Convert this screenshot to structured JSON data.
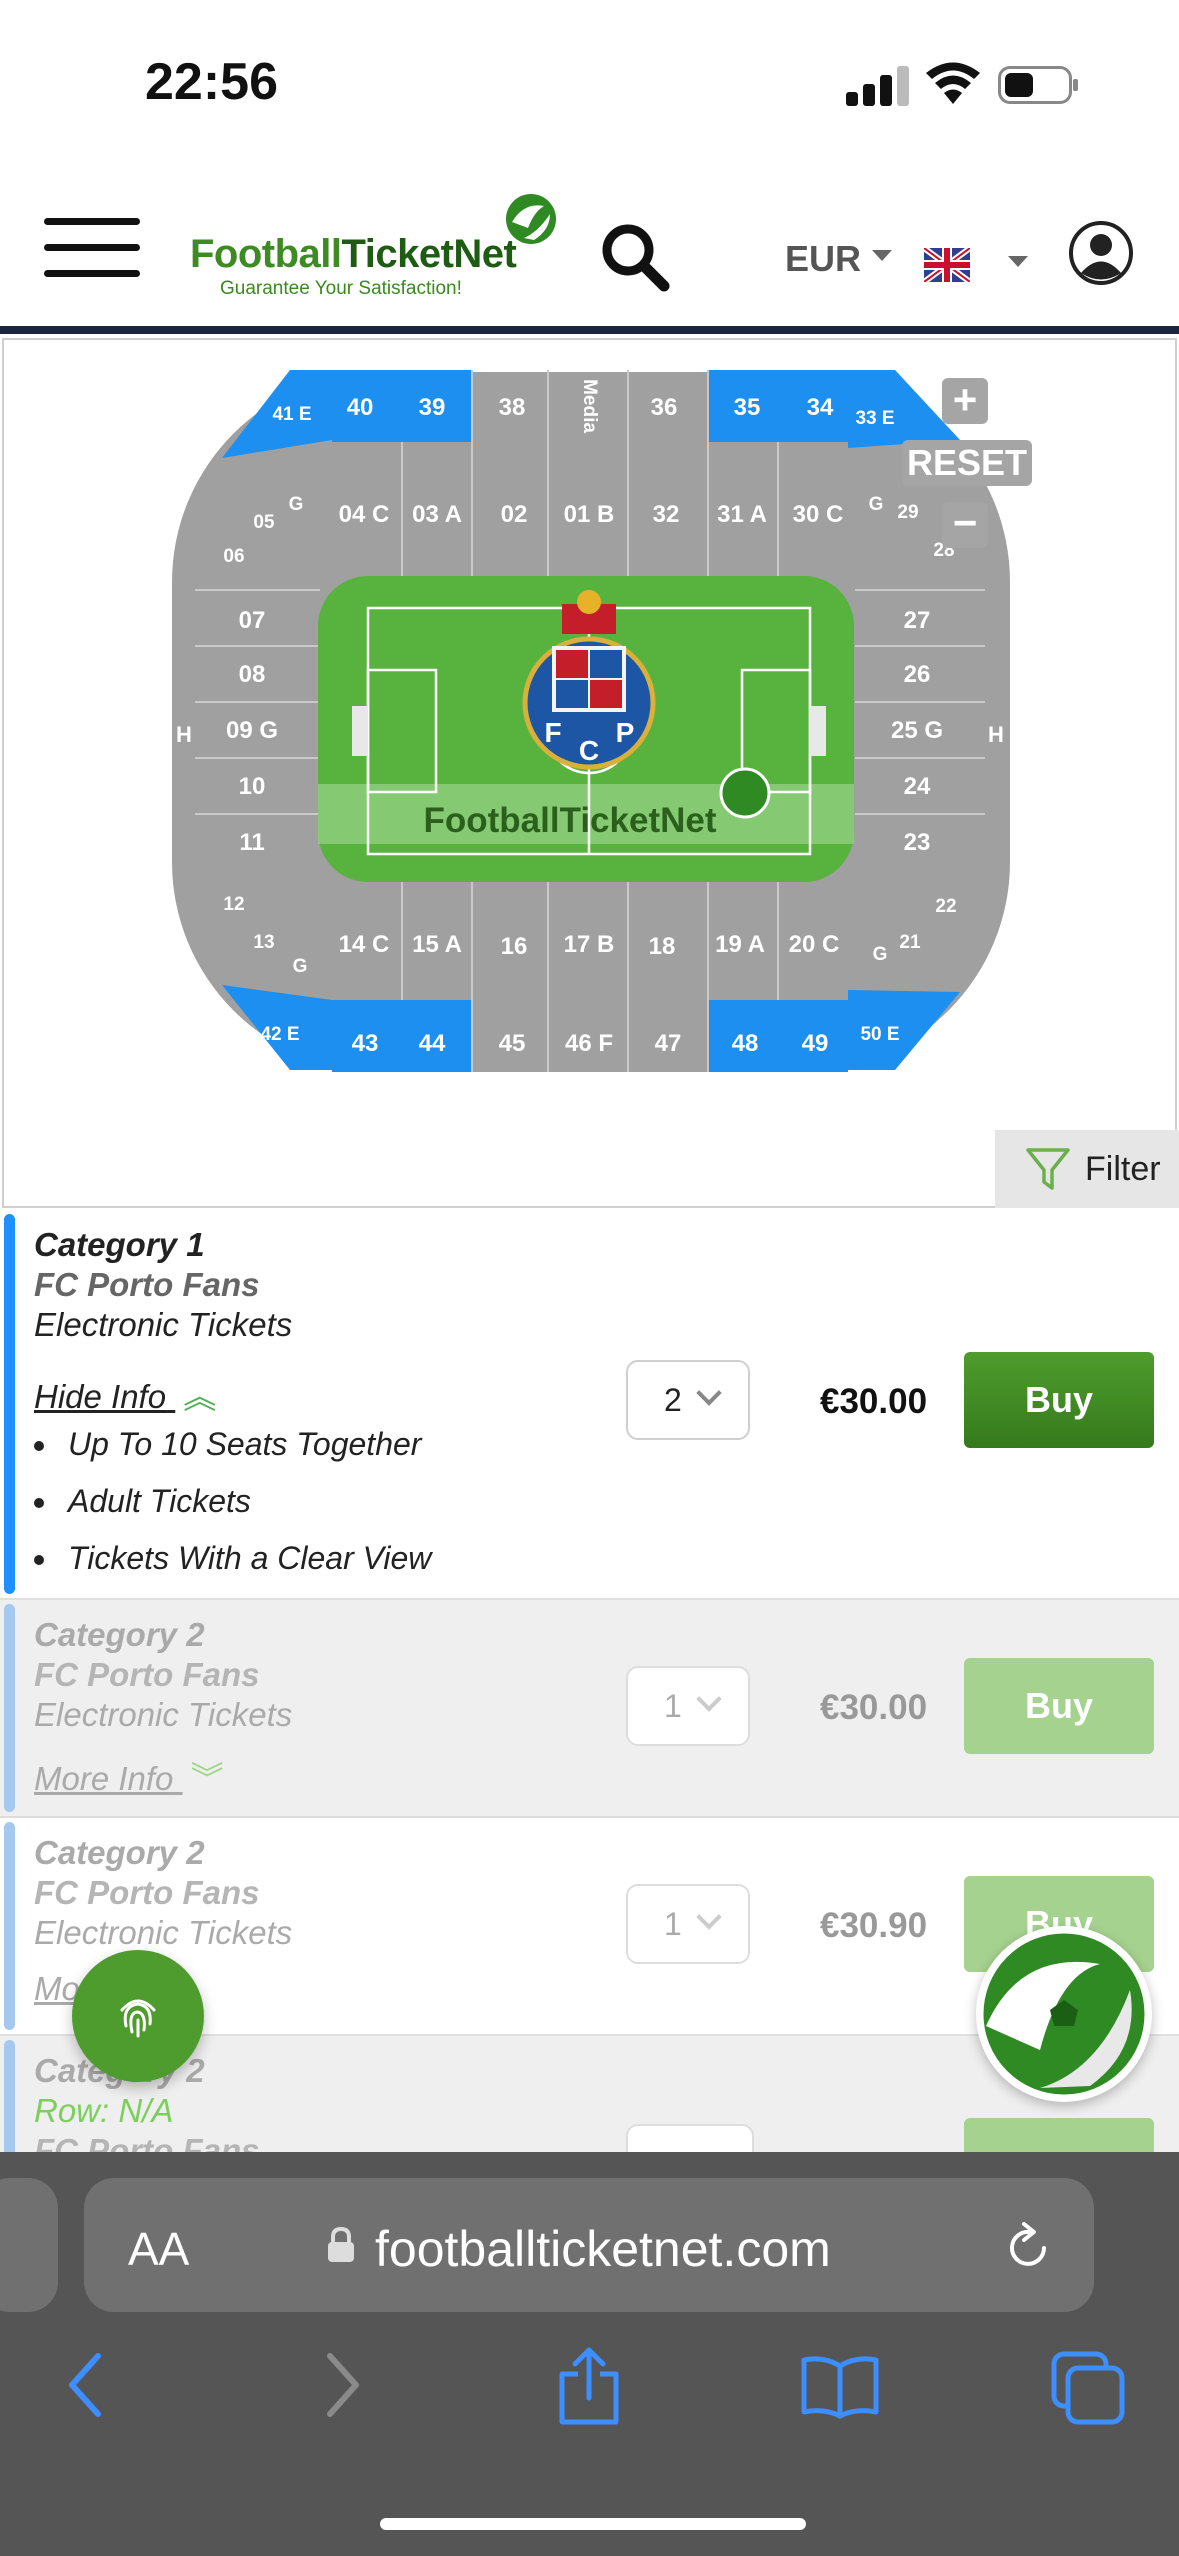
{
  "status_bar": {
    "time": "22:56"
  },
  "header": {
    "brand_part1": "Football",
    "brand_part2": "TicketNet",
    "tagline": "Guarantee Your Satisfaction!",
    "currency": "EUR",
    "language_flag": "uk-flag-icon",
    "icons": [
      "hamburger-menu-icon",
      "search-icon",
      "chevron-down-icon",
      "account-icon"
    ]
  },
  "stadium_map": {
    "zoom_in": "+",
    "reset": "RESET",
    "zoom_out": "−",
    "pitch_watermark": "FootballTicketNet",
    "crest_letters": [
      "F",
      "C",
      "P"
    ],
    "sections": {
      "top_outer": [
        "41 E",
        "40",
        "39",
        "38",
        "Media",
        "36",
        "35",
        "34",
        "33 E"
      ],
      "top_inner": [
        "G",
        "04 C",
        "03 A",
        "02",
        "01 B",
        "32",
        "31 A",
        "30 C",
        "G"
      ],
      "top_corners": [
        "05",
        "06",
        "29",
        "28"
      ],
      "left": [
        "07",
        "08",
        "09 G",
        "10",
        "11"
      ],
      "right": [
        "27",
        "26",
        "25 G",
        "24",
        "23"
      ],
      "ends": [
        "H",
        "H"
      ],
      "bottom_corners": [
        "12",
        "13",
        "22",
        "21"
      ],
      "bottom_inner": [
        "G",
        "14 C",
        "15 A",
        "16",
        "17 B",
        "18",
        "19 A",
        "20 C",
        "G"
      ],
      "bottom_outer": [
        "42 E",
        "43",
        "44",
        "45",
        "46 F",
        "47",
        "48",
        "49",
        "50 E"
      ]
    },
    "filter_label": "Filter"
  },
  "listings": [
    {
      "category": "Category 1",
      "fans": "FC Porto Fans",
      "ticket_type": "Electronic Tickets",
      "info_toggle": "Hide Info",
      "features": [
        "Up To 10 Seats Together",
        "Adult Tickets",
        "Tickets With a Clear View"
      ],
      "quantity": "2",
      "price": "€30.00",
      "buy_label": "Buy"
    },
    {
      "category": "Category 2",
      "fans": "FC Porto Fans",
      "ticket_type": "Electronic Tickets",
      "info_toggle": "More Info",
      "quantity": "1",
      "price": "€30.00",
      "buy_label": "Buy"
    },
    {
      "category": "Category 2",
      "fans": "FC Porto Fans",
      "ticket_type": "Electronic Tickets",
      "info_toggle": "Mo",
      "quantity": "1",
      "price": "€30.90",
      "buy_label": "Buy"
    },
    {
      "category": "Category 2",
      "row_info": "Row: N/A",
      "fans": "FC Porto Fans"
    }
  ],
  "browser": {
    "text_size_label": "AA",
    "url": "footballticketnet.com"
  },
  "colors": {
    "brand_green": "#3d8b22",
    "accent_blue": "#1e90ff",
    "seat_blue": "#1c8ff0",
    "stand_gray": "#a0a0a0",
    "pitch_green": "#58b23e"
  }
}
